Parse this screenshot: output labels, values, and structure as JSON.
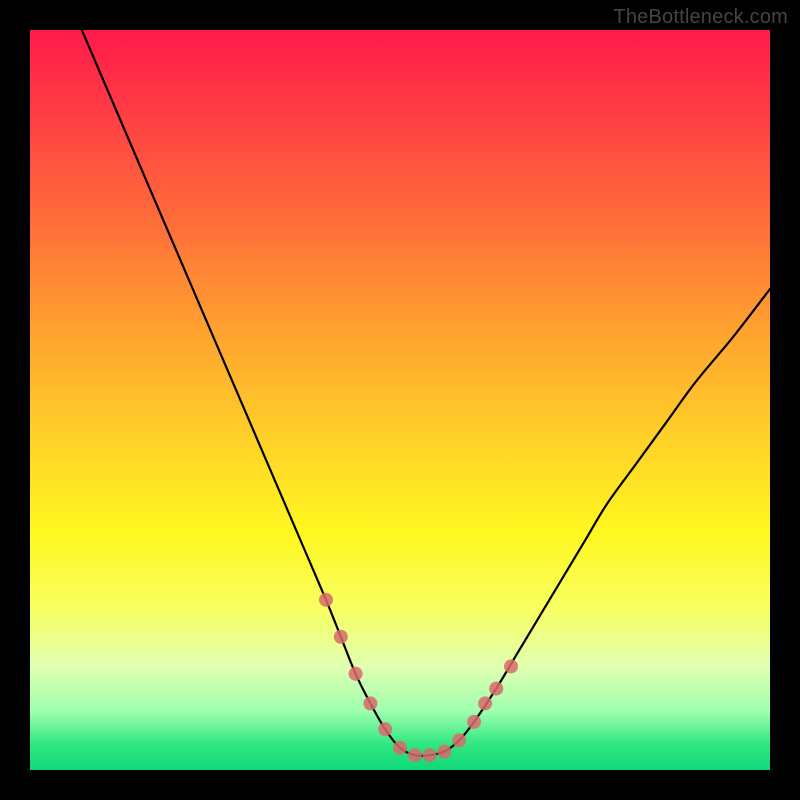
{
  "watermark": "TheBottleneck.com",
  "chart_data": {
    "type": "line",
    "title": "",
    "xlabel": "",
    "ylabel": "",
    "xlim": [
      0,
      100
    ],
    "ylim": [
      0,
      100
    ],
    "background_gradient": {
      "stops": [
        {
          "offset": 0.0,
          "color": "#ff1a4a"
        },
        {
          "offset": 0.1,
          "color": "#ff3a45"
        },
        {
          "offset": 0.25,
          "color": "#ff6a3a"
        },
        {
          "offset": 0.4,
          "color": "#ffa030"
        },
        {
          "offset": 0.55,
          "color": "#ffd028"
        },
        {
          "offset": 0.68,
          "color": "#fff820"
        },
        {
          "offset": 0.78,
          "color": "#f8ff60"
        },
        {
          "offset": 0.86,
          "color": "#e0ffb0"
        },
        {
          "offset": 0.92,
          "color": "#a0ffb0"
        },
        {
          "offset": 0.965,
          "color": "#30e880"
        },
        {
          "offset": 1.0,
          "color": "#10d878"
        }
      ]
    },
    "series": [
      {
        "name": "bottleneck-curve",
        "stroke": "#000000",
        "stroke_width": 2.2,
        "x": [
          7,
          10,
          13,
          16,
          19,
          22,
          25,
          28,
          31,
          34,
          37,
          40,
          42,
          44,
          46,
          48,
          50,
          52,
          54,
          56,
          58,
          60,
          63,
          66,
          69,
          72,
          75,
          78,
          82,
          86,
          90,
          95,
          100
        ],
        "y": [
          100,
          93,
          86,
          79,
          72,
          65,
          58,
          51,
          44,
          37,
          30,
          23,
          18,
          13,
          9,
          5.5,
          3,
          2,
          2,
          2.5,
          4,
          6.5,
          11,
          16,
          21,
          26,
          31,
          36,
          41.5,
          47,
          52.5,
          58.5,
          65
        ]
      },
      {
        "name": "marker-dots",
        "type": "scatter",
        "fill": "#d96a6a",
        "radius": 7,
        "x": [
          40,
          42,
          44,
          46,
          48,
          50,
          52,
          54,
          56,
          58,
          60,
          61.5,
          63,
          65
        ],
        "y": [
          23,
          18,
          13,
          9,
          5.5,
          3,
          2,
          2,
          2.5,
          4,
          6.5,
          9,
          11,
          14
        ]
      }
    ]
  }
}
